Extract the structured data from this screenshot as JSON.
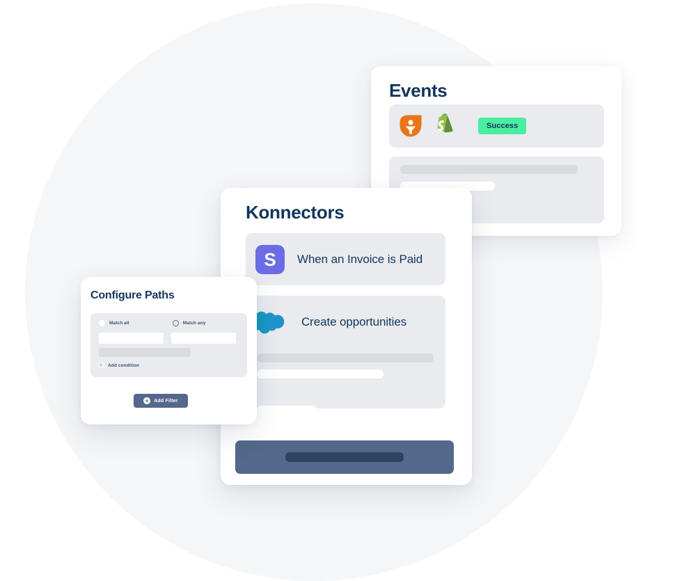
{
  "background": {
    "circle_color": "#f5f6f8",
    "page_color": "#ffffff"
  },
  "cards": {
    "events": {
      "title": "Events",
      "event_row": {
        "app_icons": [
          "pipedrive-logo-icon",
          "shopify-logo-icon"
        ],
        "status_label": "Success",
        "status_color": "#4beda1"
      },
      "skeleton_panel": {
        "bars": [
          "placeholder-bar-dark",
          "placeholder-bar-light"
        ]
      }
    },
    "konnectors": {
      "title": "Konnectors",
      "rows": [
        {
          "icon": "stripe-logo-icon",
          "icon_letter": "S",
          "label": "When an Invoice is Paid"
        },
        {
          "icon": "salesforce-logo-icon",
          "label": "Create opportunities"
        }
      ],
      "footer_button": {
        "name": "primary-action-button",
        "color": "#53688a"
      }
    },
    "configure_paths": {
      "title": "Configure Paths",
      "match_options": [
        {
          "label": "Match all",
          "selected": true
        },
        {
          "label": "Match any",
          "selected": false
        }
      ],
      "inputs": [
        {
          "value": "",
          "placeholder": ""
        },
        {
          "value": "",
          "placeholder": ""
        }
      ],
      "add_condition_label": "Add condition",
      "add_condition_icon": "plus-icon",
      "add_filter_button": {
        "label": "Add Filter",
        "icon": "plus-circle-icon",
        "color": "#53688a"
      }
    }
  },
  "colors": {
    "heading": "#12355b",
    "panel": "#e9ebef",
    "skeleton_dark": "#d9dbe0",
    "skeleton_light": "#ffffff",
    "accent_slate": "#53688a",
    "accent_slate_dark": "#2c4360",
    "success_green": "#4beda1",
    "stripe_purple": "#6c6ce5",
    "pipedrive_orange": "#e8751a",
    "shopify_green": "#7fb340",
    "salesforce_blue": "#1798c1"
  }
}
